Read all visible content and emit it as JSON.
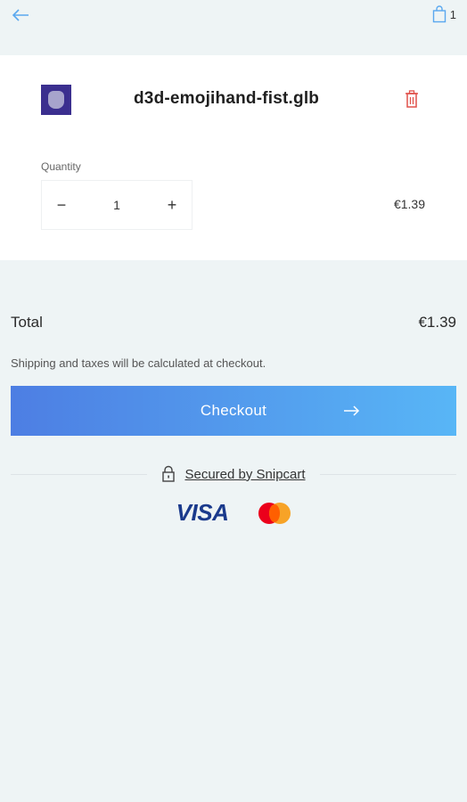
{
  "header": {
    "back_icon": "arrow-left-icon",
    "cart_icon": "shopping-bag-icon",
    "cart_count": "1"
  },
  "item": {
    "thumbnail_icon": "fist-emoji-thumbnail",
    "name": "d3d-emojihand-fist.glb",
    "delete_icon": "trash-icon",
    "quantity_label": "Quantity",
    "quantity_value": "1",
    "decrement_label": "−",
    "increment_label": "+",
    "price": "€1.39"
  },
  "summary": {
    "total_label": "Total",
    "total_value": "€1.39",
    "shipping_note": "Shipping and taxes will be calculated at checkout.",
    "checkout_label": "Checkout",
    "checkout_icon": "arrow-right-icon"
  },
  "security": {
    "lock_icon": "lock-icon",
    "secured_text": "Secured by Snipcart"
  },
  "payments": {
    "visa_text": "VISA",
    "mastercard_icon": "mastercard-logo"
  },
  "colors": {
    "background": "#eef4f5",
    "card": "#ffffff",
    "accent_start": "#4d7ee3",
    "accent_end": "#58b6f6",
    "delete": "#e0514a",
    "link_blue": "#5aa8ef"
  }
}
